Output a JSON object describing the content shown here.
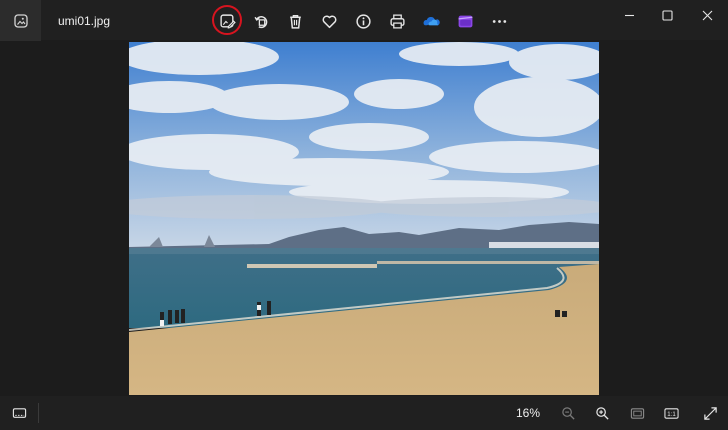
{
  "window": {
    "filename": "umi01.jpg"
  },
  "toolbar": {
    "buttons": [
      {
        "name": "edit-image-button",
        "icon": "edit-image-icon",
        "highlighted": true
      },
      {
        "name": "rotate-button",
        "icon": "rotate-icon"
      },
      {
        "name": "delete-button",
        "icon": "trash-icon"
      },
      {
        "name": "favorite-button",
        "icon": "heart-icon"
      },
      {
        "name": "file-info-button",
        "icon": "info-icon"
      },
      {
        "name": "print-button",
        "icon": "printer-icon"
      },
      {
        "name": "onedrive-button",
        "icon": "onedrive-icon"
      },
      {
        "name": "clipchamp-button",
        "icon": "clipchamp-icon"
      },
      {
        "name": "more-options-button",
        "icon": "more-icon"
      }
    ],
    "highlight_color": "#d7141f"
  },
  "window_controls": [
    "minimize-icon",
    "maximize-icon",
    "close-icon"
  ],
  "photo": {
    "description_icon": "beach-photo"
  },
  "bottombar": {
    "zoom_level": "16%",
    "buttons": [
      "filmstrip-icon",
      "zoom-out-icon",
      "zoom-in-icon",
      "fit-to-window-icon",
      "actual-size-icon",
      "fullscreen-icon"
    ],
    "actual_size_label": "1:1"
  },
  "colors": {
    "background": "#1c1c1c",
    "titlebar": "#202020",
    "onedrive_blue": "#1e6fd8",
    "clipchamp_purple": "#8a46e6"
  }
}
